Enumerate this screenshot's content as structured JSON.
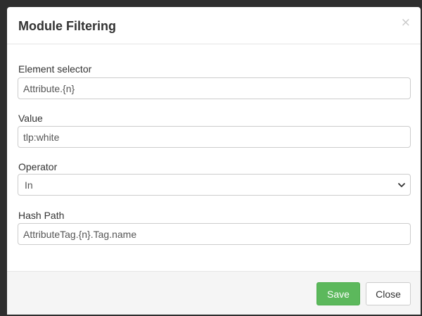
{
  "modal": {
    "title": "Module Filtering",
    "close_glyph": "×"
  },
  "fields": {
    "element_selector": {
      "label": "Element selector",
      "value": "Attribute.{n}"
    },
    "value": {
      "label": "Value",
      "value": "tlp:white"
    },
    "operator": {
      "label": "Operator",
      "selected": "In"
    },
    "hash_path": {
      "label": "Hash Path",
      "value": "AttributeTag.{n}.Tag.name"
    }
  },
  "footer": {
    "save_label": "Save",
    "close_label": "Close"
  },
  "colors": {
    "save_button": "#5cb85c",
    "footer_bg": "#f5f5f5",
    "backdrop": "#2e2e2e"
  },
  "icons": {
    "dialog_close": "close-icon",
    "select_arrow": "chevron-down-icon"
  }
}
